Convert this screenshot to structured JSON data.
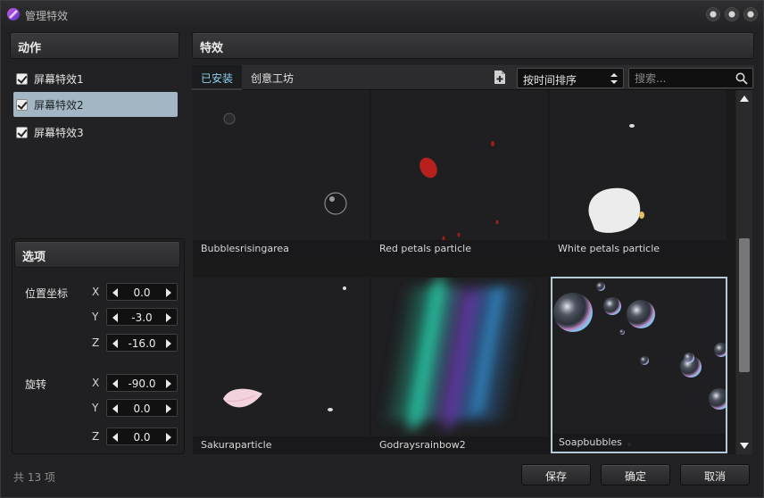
{
  "window": {
    "title": "管理特效"
  },
  "actions_panel": {
    "title": "动作",
    "items": [
      {
        "label": "屏幕特效1",
        "checked": true
      },
      {
        "label": "屏幕特效2",
        "checked": true,
        "selected": true
      },
      {
        "label": "屏幕特效3",
        "checked": true
      }
    ]
  },
  "options_panel": {
    "title": "选项",
    "position": {
      "label": "位置坐标",
      "x_label": "X",
      "x": "0.0",
      "y_label": "Y",
      "y": "-3.0",
      "z_label": "Z",
      "z": "-16.0"
    },
    "rotation": {
      "label": "旋转",
      "x_label": "X",
      "x": "-90.0",
      "y_label": "Y",
      "y": "0.0",
      "z_label": "Z",
      "z": "0.0"
    }
  },
  "effects_panel": {
    "title": "特效",
    "tabs": [
      {
        "label": "已安装",
        "active": true
      },
      {
        "label": "创意工坊",
        "active": false
      }
    ],
    "sort": {
      "selected": "按时间排序"
    },
    "search": {
      "placeholder": "搜索..."
    },
    "grid": [
      {
        "label": "Bubblesrisingarea"
      },
      {
        "label": "Red petals particle"
      },
      {
        "label": "White petals particle"
      },
      {
        "label": "Sakuraparticle"
      },
      {
        "label": "Godraysrainbow2"
      },
      {
        "label": "Soapbubbles",
        "selected": true
      }
    ]
  },
  "status": {
    "count_text": "共 13 项"
  },
  "buttons": {
    "save": "保存",
    "ok": "确定",
    "cancel": "取消"
  },
  "colors": {
    "accent": "#8fd0ec",
    "selection": "#a3b6c4",
    "cell_border": "#b4cad8"
  }
}
